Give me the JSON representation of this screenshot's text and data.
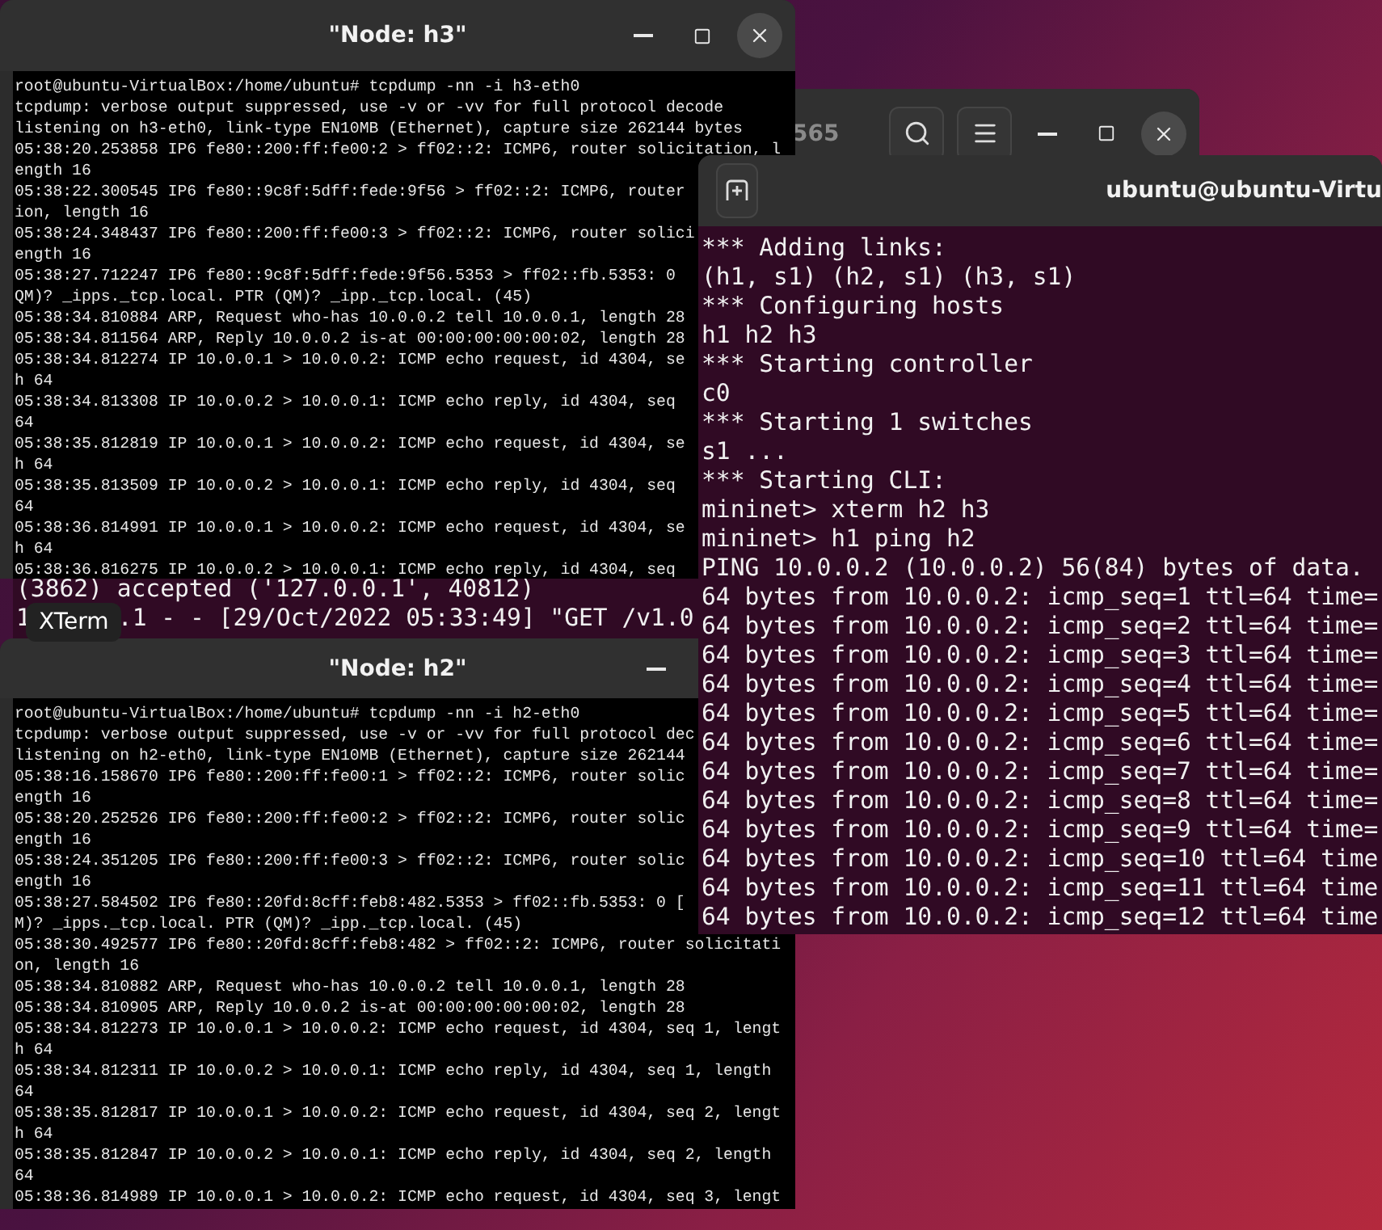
{
  "background_terminal": {
    "lines": [
      "(3862) accepted ('127.0.0.1', 40812)"
    ],
    "partial_line": {
      "before": "1",
      "after": ".1 - - [29/Oct/2022 05:33:49] \"GET /v1.0"
    }
  },
  "hidden_window": {
    "title_fragment": "565",
    "buttons": [
      {
        "kind": "search"
      },
      {
        "kind": "menu"
      },
      {
        "kind": "minimize"
      },
      {
        "kind": "maximize"
      },
      {
        "kind": "close"
      }
    ]
  },
  "xterm_h3": {
    "title": "\"Node: h3\"",
    "buttons": [
      {
        "kind": "minimize"
      },
      {
        "kind": "maximize"
      },
      {
        "kind": "close"
      }
    ],
    "lines": [
      "root@ubuntu-VirtualBox:/home/ubuntu# tcpdump -nn -i h3-eth0",
      "tcpdump: verbose output suppressed, use -v or -vv for full protocol decode",
      "listening on h3-eth0, link-type EN10MB (Ethernet), capture size 262144 bytes",
      "05:38:20.253858 IP6 fe80::200:ff:fe00:2 > ff02::2: ICMP6, router solicitation, l",
      "ength 16",
      "05:38:22.300545 IP6 fe80::9c8f:5dff:fede:9f56 > ff02::2: ICMP6, router",
      "ion, length 16",
      "05:38:24.348437 IP6 fe80::200:ff:fe00:3 > ff02::2: ICMP6, router solici",
      "ength 16",
      "05:38:27.712247 IP6 fe80::9c8f:5dff:fede:9f56.5353 > ff02::fb.5353: 0",
      "QM)? _ipps._tcp.local. PTR (QM)? _ipp._tcp.local. (45)",
      "05:38:34.810884 ARP, Request who-has 10.0.0.2 tell 10.0.0.1, length 28",
      "05:38:34.811564 ARP, Reply 10.0.0.2 is-at 00:00:00:00:00:02, length 28",
      "05:38:34.812274 IP 10.0.0.1 > 10.0.0.2: ICMP echo request, id 4304, se",
      "h 64",
      "05:38:34.813308 IP 10.0.0.2 > 10.0.0.1: ICMP echo reply, id 4304, seq",
      "64",
      "05:38:35.812819 IP 10.0.0.1 > 10.0.0.2: ICMP echo request, id 4304, se",
      "h 64",
      "05:38:35.813509 IP 10.0.0.2 > 10.0.0.1: ICMP echo reply, id 4304, seq",
      "64",
      "05:38:36.814991 IP 10.0.0.1 > 10.0.0.2: ICMP echo request, id 4304, se",
      "h 64",
      "05:38:36.816275 IP 10.0.0.2 > 10.0.0.1: ICMP echo reply, id 4304, seq"
    ]
  },
  "tooltip": {
    "label": "XTerm"
  },
  "xterm_h2": {
    "title": "\"Node: h2\"",
    "buttons": [
      {
        "kind": "minimize"
      }
    ],
    "lines": [
      "root@ubuntu-VirtualBox:/home/ubuntu# tcpdump -nn -i h2-eth0",
      "tcpdump: verbose output suppressed, use -v or -vv for full protocol dec",
      "listening on h2-eth0, link-type EN10MB (Ethernet), capture size 262144",
      "05:38:16.158670 IP6 fe80::200:ff:fe00:1 > ff02::2: ICMP6, router solic",
      "ength 16",
      "05:38:20.252526 IP6 fe80::200:ff:fe00:2 > ff02::2: ICMP6, router solic",
      "ength 16",
      "05:38:24.351205 IP6 fe80::200:ff:fe00:3 > ff02::2: ICMP6, router solic",
      "ength 16",
      "05:38:27.584502 IP6 fe80::20fd:8cff:feb8:482.5353 > ff02::fb.5353: 0 [",
      "M)? _ipps._tcp.local. PTR (QM)? _ipp._tcp.local. (45)",
      "05:38:30.492577 IP6 fe80::20fd:8cff:feb8:482 > ff02::2: ICMP6, router solicitati",
      "on, length 16",
      "05:38:34.810882 ARP, Request who-has 10.0.0.2 tell 10.0.0.1, length 28",
      "05:38:34.810905 ARP, Reply 10.0.0.2 is-at 00:00:00:00:00:02, length 28",
      "05:38:34.812273 IP 10.0.0.1 > 10.0.0.2: ICMP echo request, id 4304, seq 1, lengt",
      "h 64",
      "05:38:34.812311 IP 10.0.0.2 > 10.0.0.1: ICMP echo reply, id 4304, seq 1, length",
      "64",
      "05:38:35.812817 IP 10.0.0.1 > 10.0.0.2: ICMP echo request, id 4304, seq 2, lengt",
      "h 64",
      "05:38:35.812847 IP 10.0.0.2 > 10.0.0.1: ICMP echo reply, id 4304, seq 2, length",
      "64",
      "05:38:36.814989 IP 10.0.0.1 > 10.0.0.2: ICMP echo request, id 4304, seq 3, lengt"
    ]
  },
  "gnome_terminal": {
    "title": "ubuntu@ubuntu-Virtu",
    "lines": [
      "*** Adding links:",
      "(h1, s1) (h2, s1) (h3, s1)",
      "*** Configuring hosts",
      "h1 h2 h3",
      "*** Starting controller",
      "c0",
      "*** Starting 1 switches",
      "s1 ...",
      "*** Starting CLI:",
      "mininet> xterm h2 h3",
      "mininet> h1 ping h2",
      "PING 10.0.0.2 (10.0.0.2) 56(84) bytes of data.",
      "64 bytes from 10.0.0.2: icmp_seq=1 ttl=64 time=",
      "64 bytes from 10.0.0.2: icmp_seq=2 ttl=64 time=",
      "64 bytes from 10.0.0.2: icmp_seq=3 ttl=64 time=",
      "64 bytes from 10.0.0.2: icmp_seq=4 ttl=64 time=",
      "64 bytes from 10.0.0.2: icmp_seq=5 ttl=64 time=",
      "64 bytes from 10.0.0.2: icmp_seq=6 ttl=64 time=",
      "64 bytes from 10.0.0.2: icmp_seq=7 ttl=64 time=",
      "64 bytes from 10.0.0.2: icmp_seq=8 ttl=64 time=",
      "64 bytes from 10.0.0.2: icmp_seq=9 ttl=64 time=",
      "64 bytes from 10.0.0.2: icmp_seq=10 ttl=64 time",
      "64 bytes from 10.0.0.2: icmp_seq=11 ttl=64 time",
      "64 bytes from 10.0.0.2: icmp_seq=12 ttl=64 time"
    ]
  }
}
